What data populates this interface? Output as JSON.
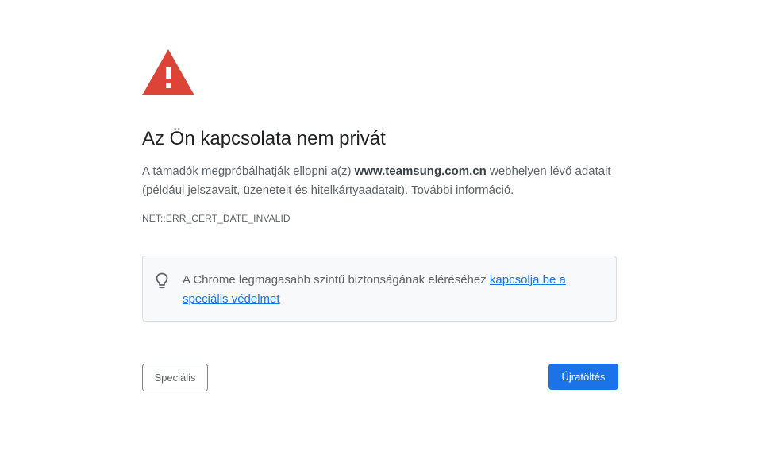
{
  "page": {
    "title": "Az Ön kapcsolata nem privát",
    "description_before": "A támadók megpróbálhatják ellopni a(z) ",
    "domain": "www.teamsung.com.cn",
    "description_after": " webhelyen lévő adatait (például jelszavait, üzeneteit és hitelkártyaadatait). ",
    "more_info_link": "További információ",
    "description_end": ".",
    "error_code": "NET::ERR_CERT_DATE_INVALID"
  },
  "protection": {
    "text": "A Chrome legmagasabb szintű biztonságának eléréséhez ",
    "link": "kapcsolja be a speciális védelmet"
  },
  "buttons": {
    "advanced": "Speciális",
    "reload": "Újratöltés"
  },
  "colors": {
    "warning_red": "#db4437",
    "primary_blue": "#1a73e8",
    "text_dark": "#202124",
    "text_secondary": "#5f6368"
  },
  "icons": {
    "warning": "warning-triangle-icon",
    "tip": "lightbulb-icon"
  }
}
